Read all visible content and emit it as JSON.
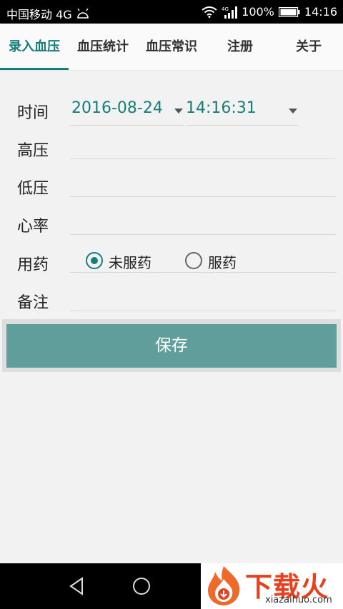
{
  "statusbar": {
    "carrier": "中国移动 4G",
    "network": "4G",
    "battery_text": "100%",
    "time": "14:16"
  },
  "tabs": [
    {
      "label": "录入血压",
      "active": true
    },
    {
      "label": "血压统计",
      "active": false
    },
    {
      "label": "血压常识",
      "active": false
    },
    {
      "label": "注册",
      "active": false
    },
    {
      "label": "关于",
      "active": false
    }
  ],
  "form": {
    "time_label": "时间",
    "date_value": "2016-08-24",
    "time_value": "14:16:31",
    "systolic_label": "高压",
    "diastolic_label": "低压",
    "heart_rate_label": "心率",
    "medication_label": "用药",
    "medication_options": [
      "未服药",
      "服药"
    ],
    "medication_selected": "未服药",
    "note_label": "备注"
  },
  "save_label": "保存",
  "colors": {
    "accent": "#177d7a",
    "button": "#5f9e9a",
    "background": "#f2f2f2"
  },
  "watermark": {
    "text": "下载火",
    "url": "xiazaihuo.com"
  }
}
